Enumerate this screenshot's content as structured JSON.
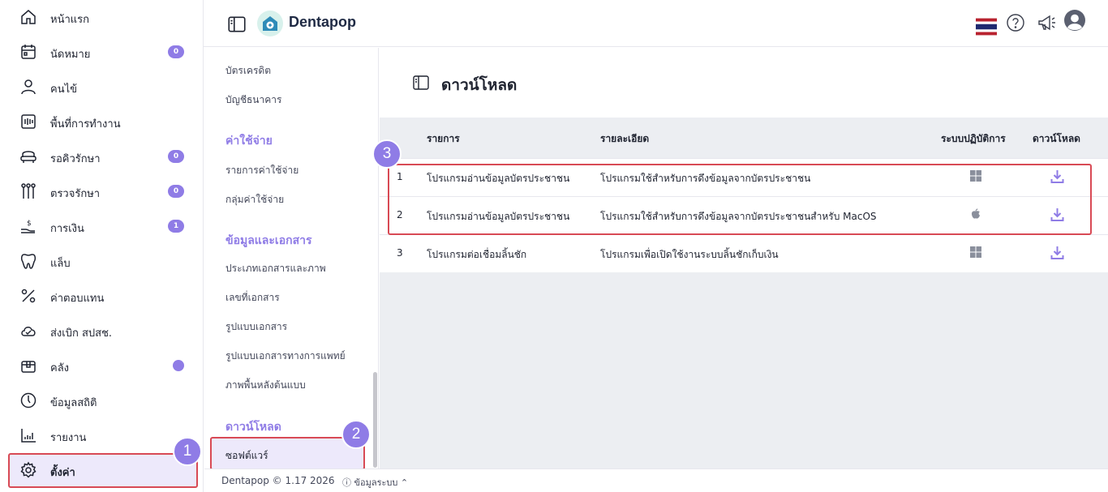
{
  "app": {
    "name": "Dentapop"
  },
  "sidebar": {
    "items": [
      {
        "label": "หน้าแรก",
        "icon": "home-icon"
      },
      {
        "label": "นัดหมาย",
        "icon": "calendar-icon",
        "badge": "0"
      },
      {
        "label": "คนไข้",
        "icon": "person-icon"
      },
      {
        "label": "พื้นที่การทำงาน",
        "icon": "workspace-icon"
      },
      {
        "label": "รอคิวรักษา",
        "icon": "dental-chair-icon",
        "badge": "0"
      },
      {
        "label": "ตรวจรักษา",
        "icon": "dental-tools-icon",
        "badge": "0"
      },
      {
        "label": "การเงิน",
        "icon": "money-hand-icon",
        "badge": "1"
      },
      {
        "label": "แล็บ",
        "icon": "tooth-icon"
      },
      {
        "label": "ค่าตอบแทน",
        "icon": "percent-icon"
      },
      {
        "label": "ส่งเบิก สปสช.",
        "icon": "cloud-check-icon"
      },
      {
        "label": "คลัง",
        "icon": "box-icon"
      },
      {
        "label": "ข้อมูลสถิติ",
        "icon": "gauge-icon"
      },
      {
        "label": "รายงาน",
        "icon": "bar-chart-icon"
      },
      {
        "label": "ตั้งค่า",
        "icon": "gear-icon"
      }
    ]
  },
  "submenu": {
    "items": [
      "บัตรเครดิต",
      "บัญชีธนาคาร"
    ],
    "sections": [
      {
        "title": "ค่าใช้จ่าย",
        "items": [
          "รายการค่าใช้จ่าย",
          "กลุ่มค่าใช้จ่าย"
        ]
      },
      {
        "title": "ข้อมูลและเอกสาร",
        "items": [
          "ประเภทเอกสารและภาพ",
          "เลขที่เอกสาร",
          "รูปแบบเอกสาร",
          "รูปแบบเอกสารทางการแพทย์",
          "ภาพพื้นหลังต้นแบบ"
        ]
      },
      {
        "title": "ดาวน์โหลด",
        "items": [
          "ซอฟต์แวร์"
        ]
      }
    ]
  },
  "main": {
    "title": "ดาวน์โหลด",
    "table": {
      "headers": [
        "รายการ",
        "รายละเอียด",
        "ระบบปฏิบัติการ",
        "ดาวน์โหลด"
      ],
      "rows": [
        {
          "no": "1",
          "name": "โปรแกรมอ่านข้อมูลบัตรประชาชน",
          "detail": "โปรแกรมใช้สำหรับการดึงข้อมูลจากบัตรประชาชน",
          "os": "windows-icon"
        },
        {
          "no": "2",
          "name": "โปรแกรมอ่านข้อมูลบัตรประชาชน",
          "detail": "โปรแกรมใช้สำหรับการดึงข้อมูลจากบัตรประชาชนสำหรับ MacOS",
          "os": "apple-icon"
        },
        {
          "no": "3",
          "name": "โปรแกรมต่อเชื่อมลิ้นชัก",
          "detail": "โปรแกรมเพื่อเปิดใช้งานระบบลิ้นชักเก็บเงิน",
          "os": "windows-icon"
        }
      ]
    }
  },
  "footer": {
    "copyright": "Dentapop © 1.17 2026",
    "system_info": "ⓘ ข้อมูลระบบ ⌃"
  },
  "markers": [
    "1",
    "2",
    "3"
  ],
  "colors": {
    "accent": "#8f7ce6",
    "highlight": "#d84a55",
    "active_bg": "#ede9fb"
  }
}
